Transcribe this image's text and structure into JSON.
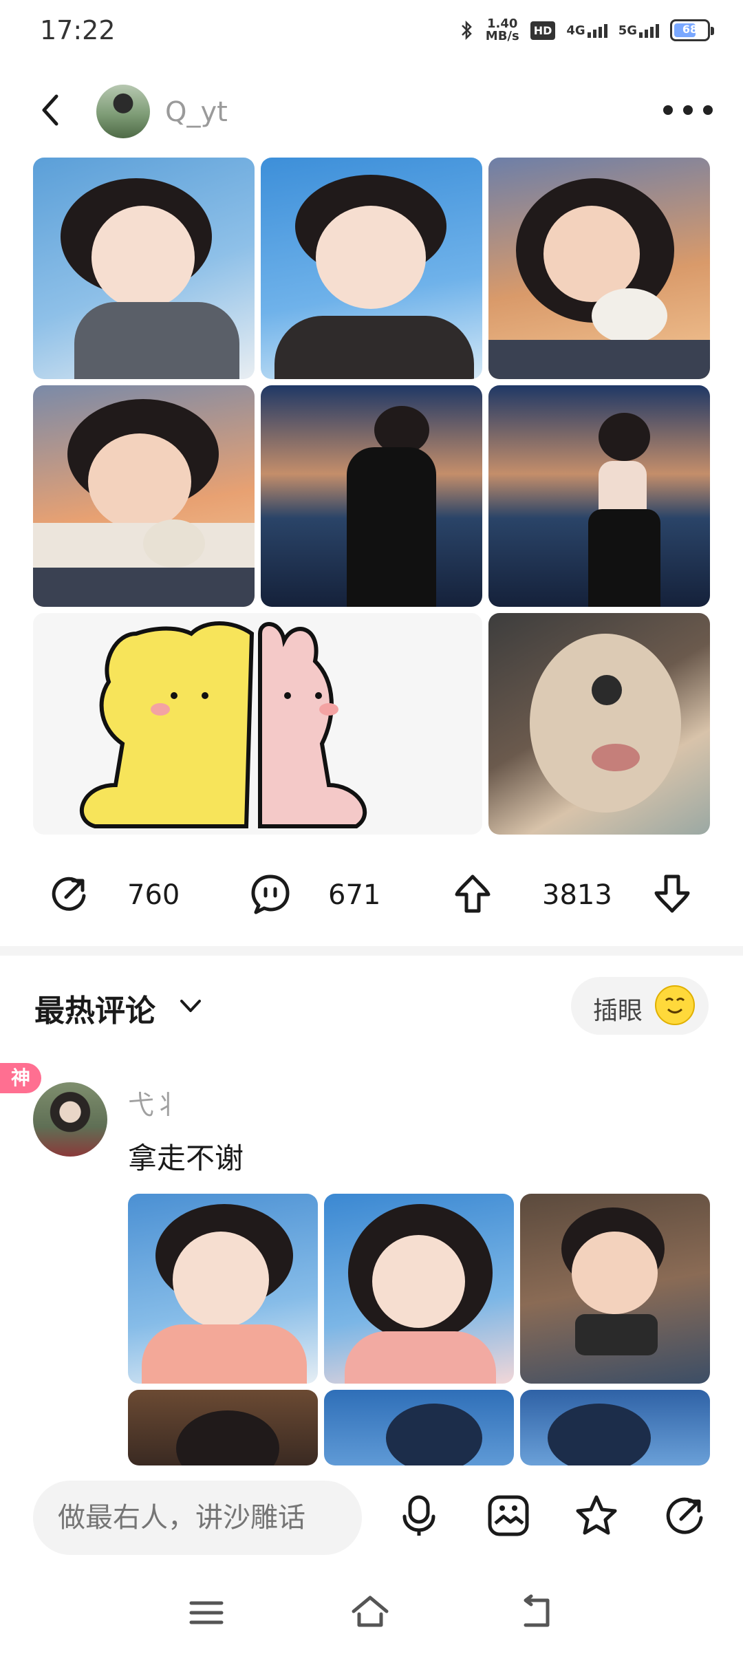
{
  "status_bar": {
    "time": "17:22",
    "net_speed_value": "1.40",
    "net_speed_unit": "MB/s",
    "hd_label": "HD",
    "sig1_label": "4G",
    "sig2_label": "5G",
    "battery_text": "68",
    "battery_level": 0.68,
    "battery_color": "#7aa8ff"
  },
  "header": {
    "username": "Q_yt"
  },
  "actions": {
    "share_count": "760",
    "comment_count": "671",
    "upvote_count": "3813"
  },
  "comments": {
    "section_title": "最热评论",
    "insert_label": "插眼",
    "badge": "神",
    "items": [
      {
        "user": "弋丬",
        "text": "拿走不谢"
      }
    ]
  },
  "input": {
    "placeholder": "做最右人，讲沙雕话"
  },
  "icons": [
    "back-icon",
    "more-icon",
    "share-icon",
    "comment-icon",
    "upvote-icon",
    "downvote-icon",
    "chevron-down-icon",
    "emoji-icon",
    "voice-icon",
    "image-icon",
    "star-icon",
    "share-icon",
    "menu-icon",
    "home-icon",
    "back-nav-icon"
  ]
}
